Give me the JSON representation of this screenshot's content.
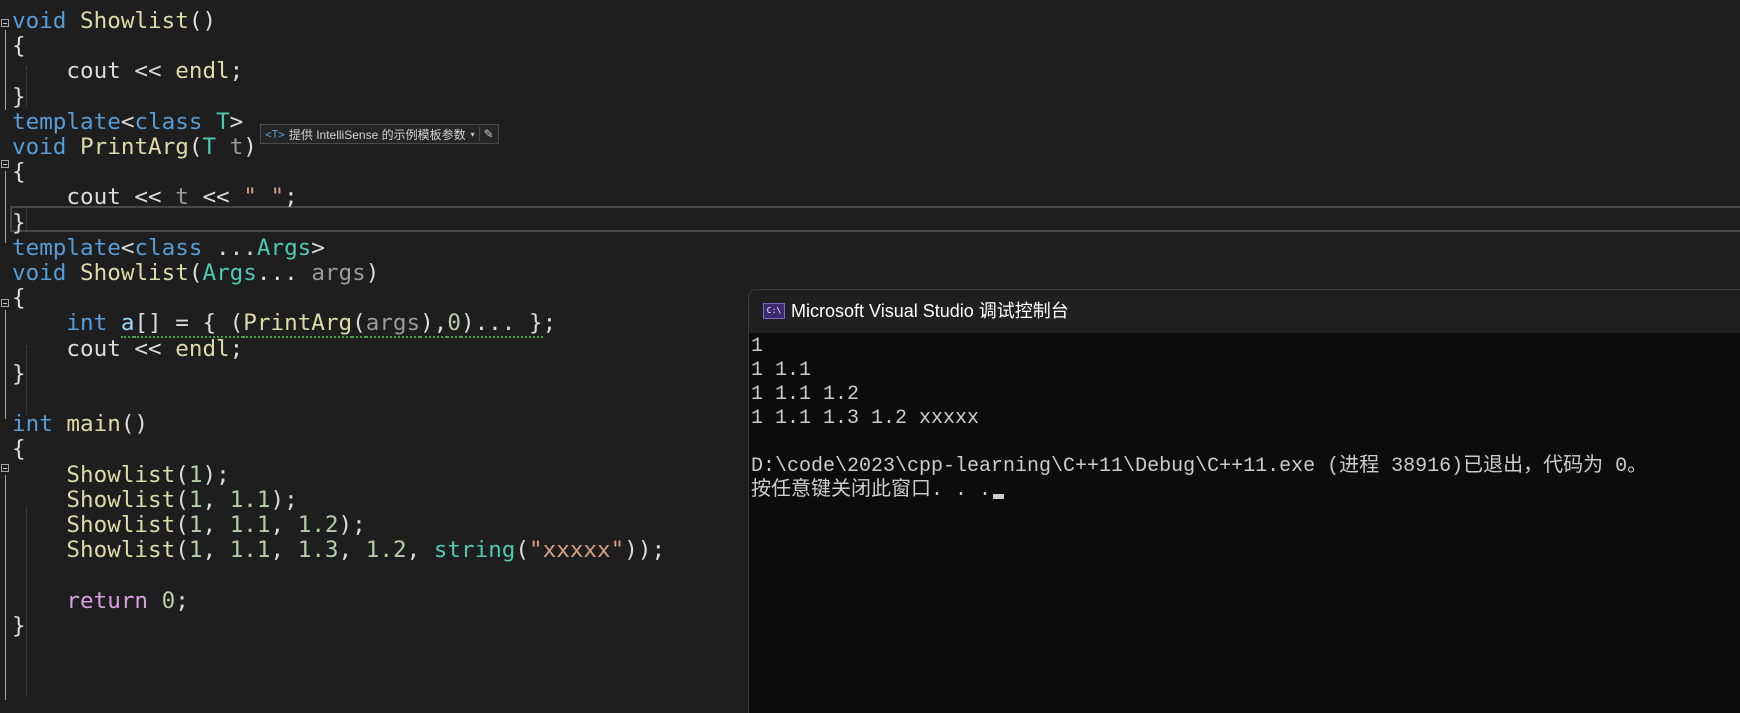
{
  "editor": {
    "hint": {
      "tag": "<T>",
      "text": "提供 IntelliSense 的示例模板参数",
      "dropdown": "▾",
      "edit_icon": "✎"
    }
  },
  "console": {
    "icon_label": "C:\\",
    "title": "Microsoft Visual Studio 调试控制台",
    "lines": [
      "1",
      "1 1.1",
      "1 1.1 1.2",
      "1 1.1 1.3 1.2 xxxxx",
      "",
      "D:\\code\\2023\\cpp-learning\\C++11\\Debug\\C++11.exe (进程 38916)已退出，代码为 0。",
      "按任意键关闭此窗口. . ."
    ]
  },
  "code_lines": [
    [
      {
        "t": "void",
        "c": "kw"
      },
      {
        "t": " "
      },
      {
        "t": "Showlist",
        "c": "fn"
      },
      {
        "t": "()"
      }
    ],
    [
      {
        "t": "{"
      }
    ],
    [
      {
        "t": "    cout << "
      },
      {
        "t": "endl",
        "c": "fn"
      },
      {
        "t": ";"
      }
    ],
    [
      {
        "t": "}"
      }
    ],
    [
      {
        "t": "template",
        "c": "kw"
      },
      {
        "t": "<"
      },
      {
        "t": "class",
        "c": "kw"
      },
      {
        "t": " "
      },
      {
        "t": "T",
        "c": "ty"
      },
      {
        "t": ">"
      }
    ],
    [
      {
        "t": "void",
        "c": "kw"
      },
      {
        "t": " "
      },
      {
        "t": "PrintArg",
        "c": "fn"
      },
      {
        "t": "("
      },
      {
        "t": "T",
        "c": "ty"
      },
      {
        "t": " "
      },
      {
        "t": "t",
        "c": "pa"
      },
      {
        "t": ")"
      }
    ],
    [
      {
        "t": "{"
      }
    ],
    [
      {
        "t": "    cout << "
      },
      {
        "t": "t",
        "c": "pa"
      },
      {
        "t": " << "
      },
      {
        "t": "\" \"",
        "c": "st"
      },
      {
        "t": ";"
      }
    ],
    [
      {
        "t": "}"
      }
    ],
    [
      {
        "t": "template",
        "c": "kw"
      },
      {
        "t": "<"
      },
      {
        "t": "class",
        "c": "kw"
      },
      {
        "t": " ..."
      },
      {
        "t": "Args",
        "c": "ty"
      },
      {
        "t": ">"
      }
    ],
    [
      {
        "t": "void",
        "c": "kw"
      },
      {
        "t": " "
      },
      {
        "t": "Showlist",
        "c": "fn"
      },
      {
        "t": "("
      },
      {
        "t": "Args",
        "c": "ty"
      },
      {
        "t": "... "
      },
      {
        "t": "args",
        "c": "pa"
      },
      {
        "t": ")"
      }
    ],
    [
      {
        "t": "{"
      }
    ],
    [
      {
        "t": "    "
      },
      {
        "t": "int",
        "c": "kw"
      },
      {
        "t": " "
      },
      {
        "t": "a",
        "c": "lv squig"
      },
      {
        "t": "[] = { (",
        "c": "squig"
      },
      {
        "t": "PrintArg",
        "c": "fn squig"
      },
      {
        "t": "(",
        "c": "squig"
      },
      {
        "t": "args",
        "c": "pa squig"
      },
      {
        "t": "),",
        "c": "squig"
      },
      {
        "t": "0",
        "c": "nu squig"
      },
      {
        "t": ")... }",
        "c": "squig"
      },
      {
        "t": ";"
      }
    ],
    [
      {
        "t": "    cout << "
      },
      {
        "t": "endl",
        "c": "fn"
      },
      {
        "t": ";"
      }
    ],
    [
      {
        "t": "}"
      }
    ],
    [],
    [
      {
        "t": "int",
        "c": "kw"
      },
      {
        "t": " "
      },
      {
        "t": "main",
        "c": "fn"
      },
      {
        "t": "()"
      }
    ],
    [
      {
        "t": "{"
      }
    ],
    [
      {
        "t": "    "
      },
      {
        "t": "Showlist",
        "c": "fn"
      },
      {
        "t": "("
      },
      {
        "t": "1",
        "c": "nu"
      },
      {
        "t": ");"
      }
    ],
    [
      {
        "t": "    "
      },
      {
        "t": "Showlist",
        "c": "fn"
      },
      {
        "t": "("
      },
      {
        "t": "1",
        "c": "nu"
      },
      {
        "t": ", "
      },
      {
        "t": "1.1",
        "c": "nu"
      },
      {
        "t": ");"
      }
    ],
    [
      {
        "t": "    "
      },
      {
        "t": "Showlist",
        "c": "fn"
      },
      {
        "t": "("
      },
      {
        "t": "1",
        "c": "nu"
      },
      {
        "t": ", "
      },
      {
        "t": "1.1",
        "c": "nu"
      },
      {
        "t": ", "
      },
      {
        "t": "1.2",
        "c": "nu"
      },
      {
        "t": ");"
      }
    ],
    [
      {
        "t": "    "
      },
      {
        "t": "Showlist",
        "c": "fn"
      },
      {
        "t": "("
      },
      {
        "t": "1",
        "c": "nu"
      },
      {
        "t": ", "
      },
      {
        "t": "1.1",
        "c": "nu"
      },
      {
        "t": ", "
      },
      {
        "t": "1.3",
        "c": "nu"
      },
      {
        "t": ", "
      },
      {
        "t": "1.2",
        "c": "nu"
      },
      {
        "t": ", "
      },
      {
        "t": "string",
        "c": "ty"
      },
      {
        "t": "("
      },
      {
        "t": "\"xxxxx\"",
        "c": "st"
      },
      {
        "t": "));"
      }
    ],
    [],
    [
      {
        "t": "    "
      },
      {
        "t": "return",
        "c": "ct"
      },
      {
        "t": " "
      },
      {
        "t": "0",
        "c": "nu"
      },
      {
        "t": ";"
      }
    ],
    [
      {
        "t": "}"
      }
    ]
  ]
}
